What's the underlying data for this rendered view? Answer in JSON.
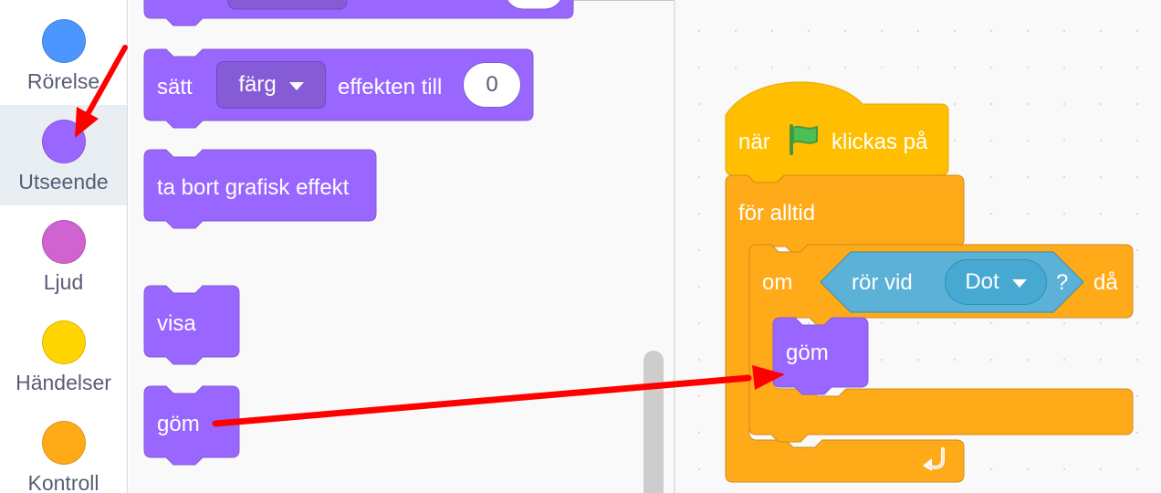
{
  "categories": [
    {
      "label": "Rörelse",
      "color": "#4c97ff"
    },
    {
      "label": "Utseende",
      "color": "#9966ff",
      "selected": true
    },
    {
      "label": "Ljud",
      "color": "#cf63cf"
    },
    {
      "label": "Händelser",
      "color": "#ffd500"
    },
    {
      "label": "Kontroll",
      "color": "#ffab19"
    }
  ],
  "flyout": {
    "set_effect": {
      "verb": "sätt",
      "effect_option": "färg",
      "suffix": "effekten till",
      "value": "0"
    },
    "clear_effects": "ta bort grafisk effekt",
    "show": "visa",
    "hide": "göm"
  },
  "script": {
    "hat": {
      "prefix": "när",
      "flag_icon": "green-flag-icon",
      "suffix": "klickas på"
    },
    "forever": "för alltid",
    "if_block": {
      "prefix": "om",
      "suffix": "då"
    },
    "sensing": {
      "label": "rör vid",
      "target": "Dot",
      "question": "?"
    },
    "inner": "göm",
    "loop_icon": "repeat-arrow-icon"
  },
  "colors": {
    "looks": "#9966ff",
    "looks_dark": "#855cd6",
    "events": "#ffbf00",
    "control": "#ffab19",
    "sensing": "#5cb1d6",
    "annotation_arrow": "#ff0000"
  }
}
